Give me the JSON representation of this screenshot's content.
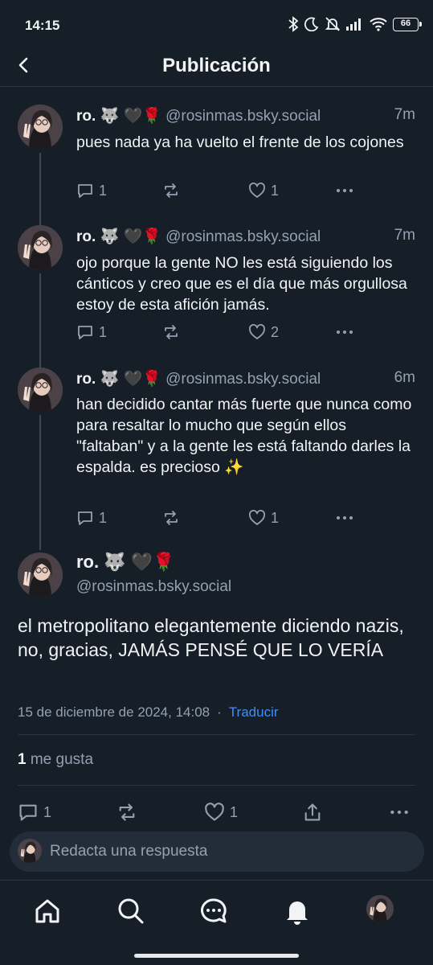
{
  "status_bar": {
    "time": "14:15",
    "battery": "66"
  },
  "header": {
    "title": "Publicación"
  },
  "thread": [
    {
      "name": "ro. 🐺 🖤🌹",
      "handle": "@rosinmas.bsky.social",
      "time": "7m",
      "text": "pues nada ya ha vuelto el frente de los cojones",
      "replies": "1",
      "reposts": "",
      "likes": "1"
    },
    {
      "name": "ro. 🐺 🖤🌹",
      "handle": "@rosinmas.bsky.social",
      "time": "7m",
      "text": "ojo porque la gente NO les está siguiendo los cánticos y creo que es el día que más orgullosa estoy de esta afición jamás.",
      "replies": "1",
      "reposts": "",
      "likes": "2"
    },
    {
      "name": "ro. 🐺 🖤🌹",
      "handle": "@rosinmas.bsky.social",
      "time": "6m",
      "text": "han decidido cantar más fuerte que nunca como para resaltar lo mucho que según ellos \"faltaban\" y a la gente les está faltando darles la espalda. es precioso ✨",
      "replies": "1",
      "reposts": "",
      "likes": "1"
    }
  ],
  "main_post": {
    "name": "ro. 🐺 🖤🌹",
    "handle": "@rosinmas.bsky.social",
    "text": "el metropolitano elegantemente diciendo nazis, no, gracias, JAMÁS PENSÉ QUE LO VERÍA",
    "date": "15 de diciembre de 2024, 14:08",
    "separator": "·",
    "translate_label": "Traducir",
    "likes_count": "1",
    "likes_label": "me gusta",
    "replies": "1",
    "likes": "1"
  },
  "reply_bar": {
    "placeholder": "Redacta una respuesta"
  },
  "colors": {
    "background": "#161e27",
    "accent": "#3f8ef5",
    "muted": "#93a1b2"
  }
}
